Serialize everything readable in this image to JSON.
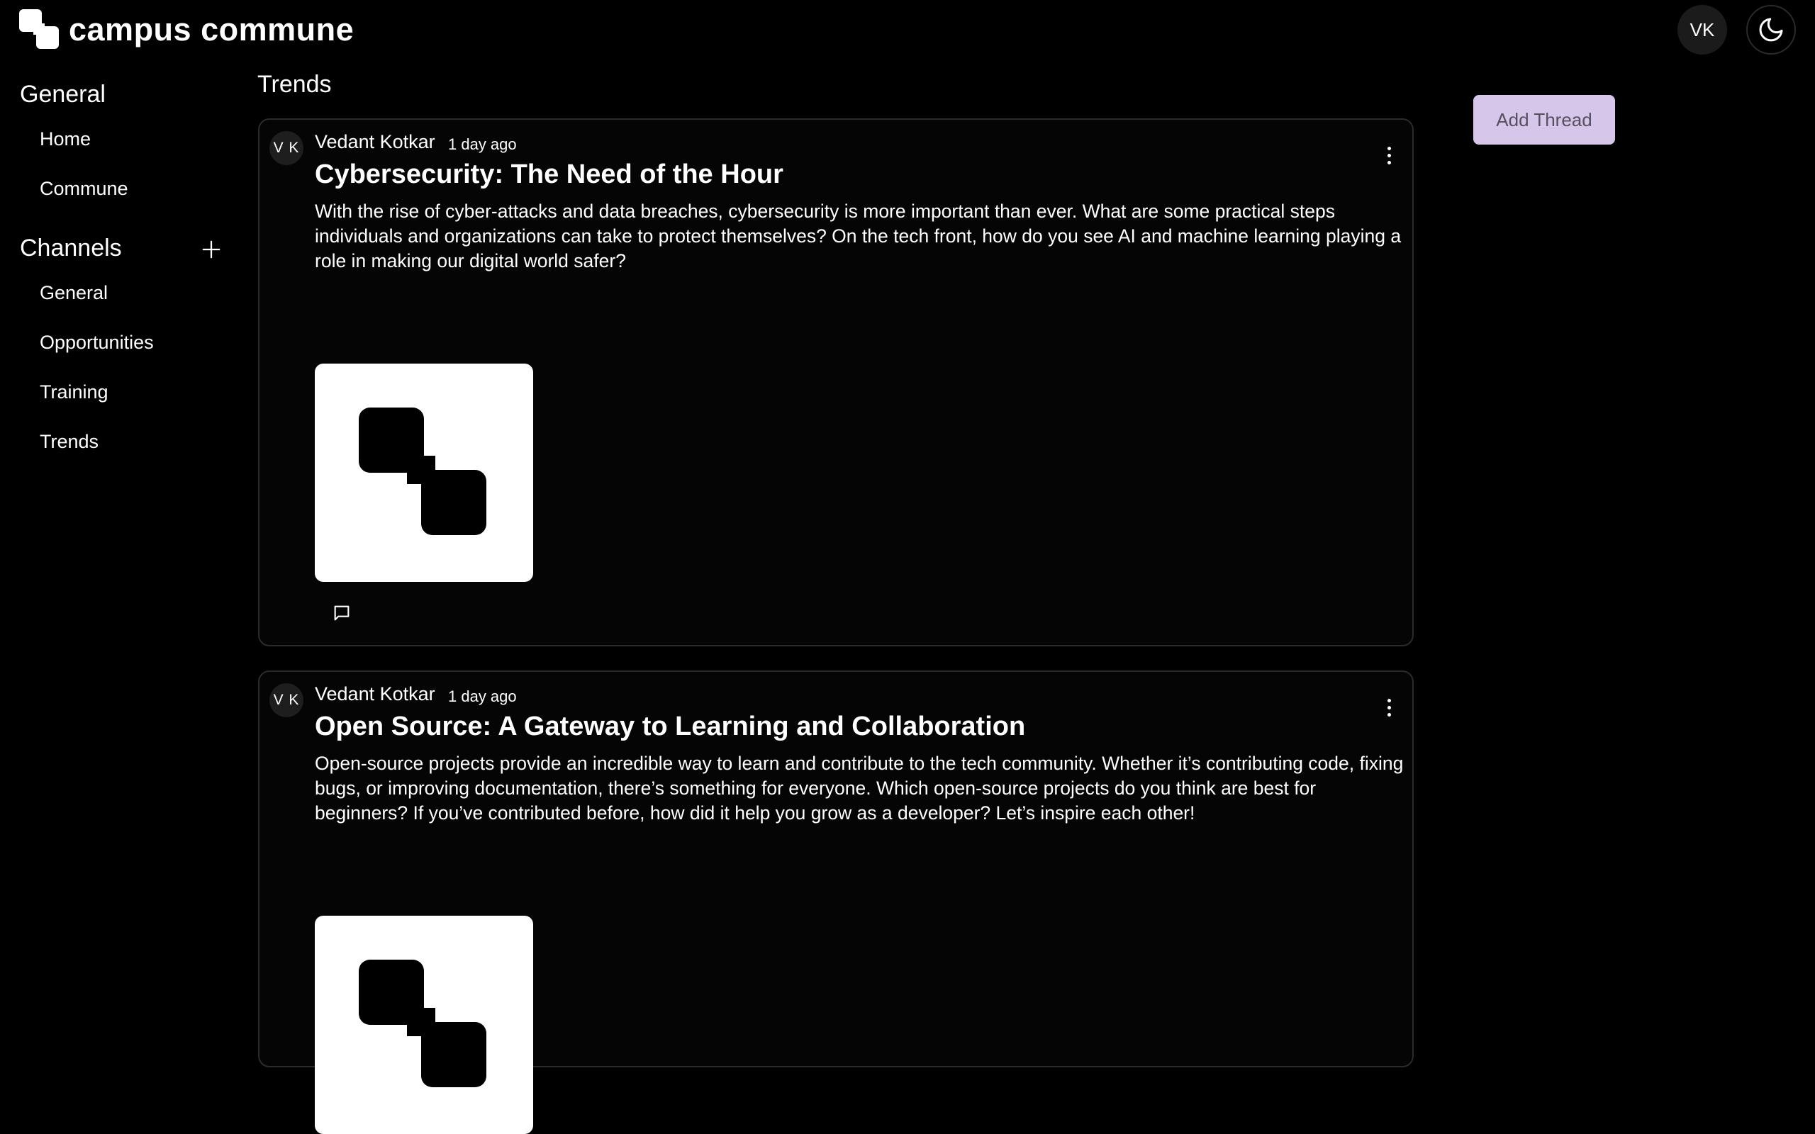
{
  "app": {
    "name": "campus commune",
    "user_initials": "VK"
  },
  "sidebar": {
    "general_title": "General",
    "general_items": [
      {
        "label": "Home"
      },
      {
        "label": "Commune"
      }
    ],
    "channels_title": "Channels",
    "channel_items": [
      {
        "label": "General"
      },
      {
        "label": "Opportunities"
      },
      {
        "label": "Training"
      },
      {
        "label": "Trends"
      }
    ]
  },
  "main": {
    "page_title": "Trends",
    "add_thread_label": "Add Thread",
    "threads": [
      {
        "avatar_initials": "V K",
        "author": "Vedant Kotkar",
        "time": "1 day ago",
        "title": "Cybersecurity: The Need of the Hour",
        "body": "With the rise of cyber-attacks and data breaches, cybersecurity is more important than ever. What are some practical steps individuals and organizations can take to protect themselves? On the tech front, how do you see AI and machine learning playing a role in making our digital world safer?"
      },
      {
        "avatar_initials": "V K",
        "author": "Vedant Kotkar",
        "time": "1 day ago",
        "title": "Open Source: A Gateway to Learning and Collaboration",
        "body": "Open-source projects provide an incredible way to learn and contribute to the tech community. Whether it’s contributing code, fixing bugs, or improving documentation, there’s something for everyone. Which open-source projects do you think are best for beginners? If you’ve contributed before, how did it help you grow as a developer? Let’s inspire each other!"
      }
    ]
  },
  "icons": {
    "logo": "campus-commune-logo-icon",
    "theme_toggle": "moon-icon",
    "add_channel": "plus-icon",
    "thread_menu": "more-vertical-icon",
    "comment": "comment-icon"
  },
  "colors": {
    "background": "#000000",
    "add_thread_bg": "#d5c6ea",
    "card_border": "#2b2b2b"
  }
}
